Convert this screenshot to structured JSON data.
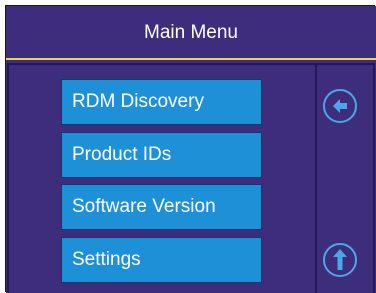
{
  "header": {
    "title": "Main Menu"
  },
  "menu": {
    "items": [
      {
        "label": "RDM Discovery"
      },
      {
        "label": "Product IDs"
      },
      {
        "label": "Software Version"
      },
      {
        "label": "Settings"
      }
    ]
  },
  "side_buttons": [
    {
      "icon": "return-icon"
    },
    {
      "icon": "arrow-up-icon"
    }
  ],
  "colors": {
    "background": "#3d2d7c",
    "header_line": "#e8d93a",
    "button": "#1e90d8",
    "text": "#ffffff"
  }
}
